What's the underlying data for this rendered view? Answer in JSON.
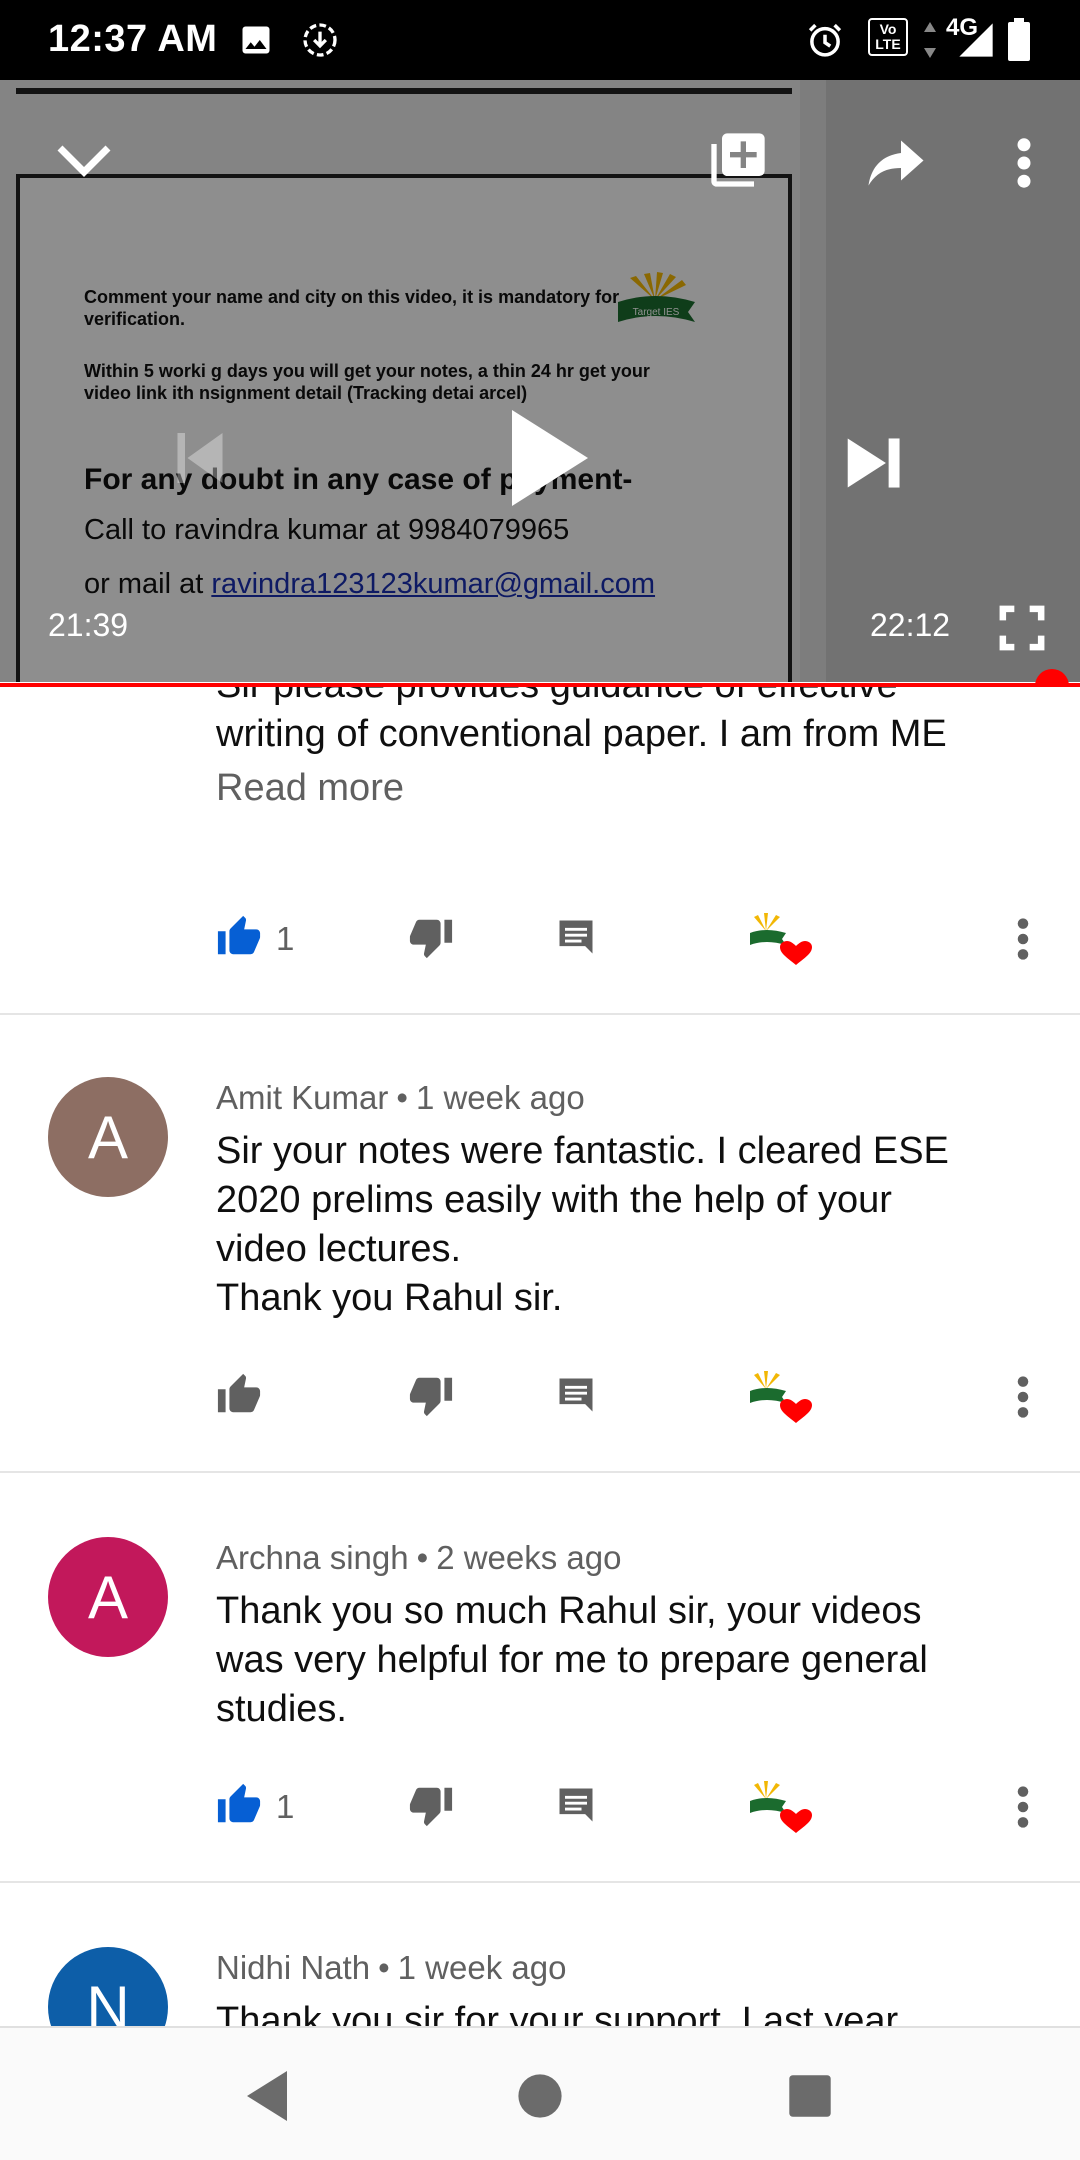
{
  "status_bar": {
    "time": "12:37 AM",
    "network": "4G",
    "volte": "Vo LTE"
  },
  "player": {
    "elapsed": "21:39",
    "duration": "22:12",
    "progress": 0.974,
    "slide": {
      "logo_text": "Target IES",
      "line1": "Comment your name and city on this video, it is mandatory for",
      "line1b": "verification.",
      "line2": "Within 5 worki g days you will get your notes, a thin 24 hr get your",
      "line2b": "video link  ith  nsignment detail (Tracking detai  arcel)",
      "heading": "For any doubt in any case of payment-",
      "call": "Call to ravindra kumar at 9984079965",
      "mail_prefix": "or mail at ",
      "mail": "ravindra123123kumar@gmail.com"
    }
  },
  "comments": [
    {
      "partial_text_top": "Sir please provides guidance of effective",
      "text": "writing of conventional paper. I am from ME",
      "read_more": "Read more",
      "likes": "1",
      "liked": true
    },
    {
      "initial": "A",
      "author": "Amit Kumar",
      "age": "1 week ago",
      "avatar_color": "#8d6e63",
      "text_lines": [
        "Sir your notes were fantastic. I cleared ESE",
        "2020 prelims easily with the help of your",
        "video lectures.",
        "Thank you Rahul sir."
      ],
      "likes": "",
      "liked": false
    },
    {
      "initial": "A",
      "author": "Archna singh",
      "age": "2 weeks ago",
      "avatar_color": "#c2185b",
      "text_lines": [
        "Thank you so much Rahul sir, your videos",
        "was very helpful for me to prepare general",
        "studies."
      ],
      "likes": "1",
      "liked": true
    },
    {
      "initial": "N",
      "author": "Nidhi Nath",
      "age": "1 week ago",
      "avatar_color": "#0d5ea8",
      "text_partial": "Thank you sir for your support. Last year"
    }
  ],
  "colors": {
    "accent_blue": "#065fd4",
    "progress_red": "#ff0000",
    "heart_red": "#ff0000"
  },
  "icons": {
    "collapse": "chevron-down-icon",
    "add_to_playlist": "playlist-add-icon",
    "share": "share-icon",
    "more": "more-vertical-icon",
    "play": "play-icon",
    "next": "skip-next-icon",
    "fullscreen": "fullscreen-icon",
    "like": "thumb-up-icon",
    "dislike": "thumb-down-icon",
    "reply": "reply-icon",
    "creator_heart": "creator-heart-icon"
  }
}
